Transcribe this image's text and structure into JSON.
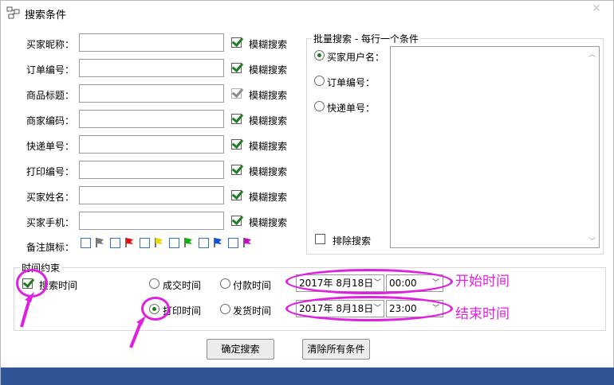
{
  "window": {
    "title": "搜索条件",
    "close": "✕"
  },
  "fields": [
    {
      "label": "买家昵称：",
      "value": "",
      "fuzzy_label": "模糊搜索",
      "fuzzy_checked": true,
      "fuzzy_disabled": false
    },
    {
      "label": "订单编号：",
      "value": "",
      "fuzzy_label": "模糊搜索",
      "fuzzy_checked": true,
      "fuzzy_disabled": false
    },
    {
      "label": "商品标题：",
      "value": "",
      "fuzzy_label": "模糊搜索",
      "fuzzy_checked": true,
      "fuzzy_disabled": true
    },
    {
      "label": "商家编码：",
      "value": "",
      "fuzzy_label": "模糊搜索",
      "fuzzy_checked": true,
      "fuzzy_disabled": false
    },
    {
      "label": "快递单号：",
      "value": "",
      "fuzzy_label": "模糊搜索",
      "fuzzy_checked": true,
      "fuzzy_disabled": false
    },
    {
      "label": "打印编号：",
      "value": "",
      "fuzzy_label": "模糊搜索",
      "fuzzy_checked": true,
      "fuzzy_disabled": false
    },
    {
      "label": "买家姓名：",
      "value": "",
      "fuzzy_label": "模糊搜索",
      "fuzzy_checked": true,
      "fuzzy_disabled": false
    },
    {
      "label": "买家手机：",
      "value": "",
      "fuzzy_label": "模糊搜索",
      "fuzzy_checked": true,
      "fuzzy_disabled": false
    }
  ],
  "remark_flags": {
    "label": "备注旗标：",
    "flags": [
      {
        "icon": "gray-flag-icon",
        "color": "#7a7a7a",
        "checked": false
      },
      {
        "icon": "red-flag-icon",
        "color": "#e01010",
        "checked": false
      },
      {
        "icon": "yellow-flag-icon",
        "color": "#e8d800",
        "checked": false
      },
      {
        "icon": "green-flag-icon",
        "color": "#10b010",
        "checked": false
      },
      {
        "icon": "blue-flag-icon",
        "color": "#1050e0",
        "checked": false
      },
      {
        "icon": "purple-flag-icon",
        "color": "#c010c0",
        "checked": false
      }
    ]
  },
  "batch": {
    "title": "批量搜索 - 每行一个条件",
    "options": [
      {
        "label": "买家用户名：",
        "selected": true
      },
      {
        "label": "订单编号：",
        "selected": false
      },
      {
        "label": "快递单号：",
        "selected": false
      }
    ],
    "exclude_label": "排除搜索",
    "exclude_checked": false,
    "textarea_value": ""
  },
  "time": {
    "title": "时间约束",
    "search_time_label": "搜索时间",
    "search_time_checked": true,
    "types": [
      {
        "label": "成交时间",
        "selected": false
      },
      {
        "label": "付款时间",
        "selected": false
      },
      {
        "label": "打印时间",
        "selected": true
      },
      {
        "label": "发货时间",
        "selected": false
      }
    ],
    "start_date": "2017年  8月18日",
    "start_time": "00:00",
    "end_date": "2017年  8月18日",
    "end_time": "23:00"
  },
  "annotations": {
    "start_label": "开始时间",
    "end_label": "结束时间",
    "color": "#e020e0"
  },
  "buttons": {
    "confirm": "确定搜索",
    "clear": "清除所有条件"
  },
  "colors": {
    "check_green": "#1e7a1e",
    "bottom_bar": "#2f5597"
  }
}
